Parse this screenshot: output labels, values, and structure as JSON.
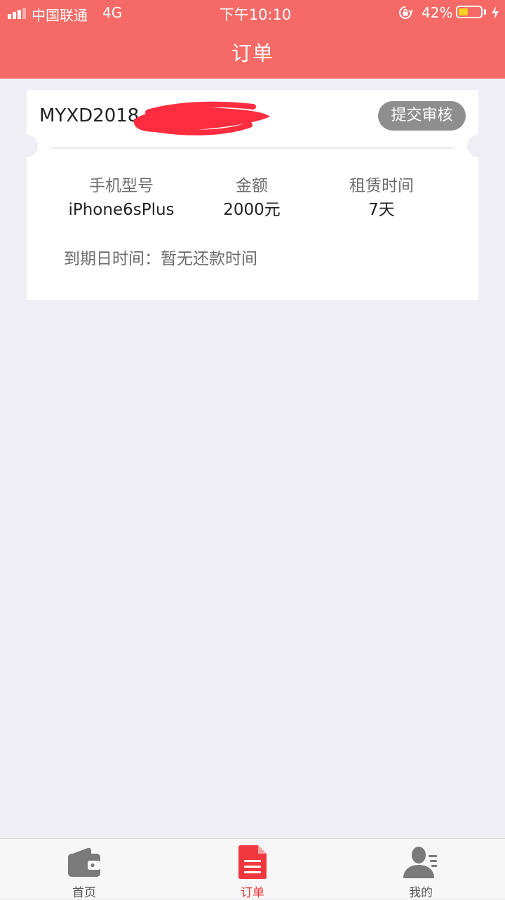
{
  "status_bar": {
    "carrier": "中国联通",
    "network": "4G",
    "time": "下午10:10",
    "battery": "42%",
    "battery_level": 0.42
  },
  "header": {
    "title": "订单"
  },
  "order": {
    "number": "MYXD2018",
    "submit_label": "提交审核",
    "fields": [
      {
        "label": "手机型号",
        "value": "iPhone6sPlus"
      },
      {
        "label": "金额",
        "value": "2000元"
      },
      {
        "label": "租赁时间",
        "value": "7天"
      }
    ],
    "due_label": "到期日时间：",
    "due_value": "暂无还款时间"
  },
  "tabs": [
    {
      "label": "首页",
      "icon": "wallet-icon",
      "active": false
    },
    {
      "label": "订单",
      "icon": "document-icon",
      "active": true
    },
    {
      "label": "我的",
      "icon": "user-icon",
      "active": false
    }
  ],
  "colors": {
    "header": "#f56a66",
    "accent": "#f0383e",
    "background": "#efeef4",
    "button": "#8e8e8e"
  }
}
